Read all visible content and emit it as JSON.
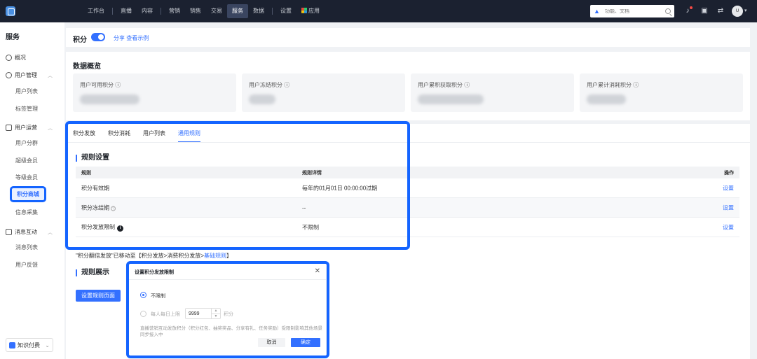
{
  "topbar": {
    "nav": [
      "工作台",
      "直播",
      "内容",
      "营销",
      "销售",
      "交易",
      "服务",
      "数据",
      "设置",
      "应用"
    ],
    "active_nav": "服务",
    "search_placeholder": "功能、文档",
    "avatar_text": "U"
  },
  "sidebar": {
    "title": "服务",
    "overview": "概况",
    "user_mgmt": "用户管理",
    "user_list": "用户列表",
    "tag_mgmt": "标签管理",
    "user_ops": "用户运营",
    "user_group": "用户分群",
    "super_member": "超级会员",
    "level_member": "等级会员",
    "points_mall": "积分商城",
    "info_collect": "信息采集",
    "msg_interact": "消息互动",
    "msg_list": "消息列表",
    "user_feedback": "用户反馈",
    "bottom_label": "知识付费"
  },
  "header": {
    "title": "积分",
    "links": "分享  查看示例",
    "toggle_on": true
  },
  "overview": {
    "title": "数据概览",
    "cards": [
      "用户可用积分 ⓘ",
      "用户冻结积分 ⓘ",
      "用户累积获取积分 ⓘ",
      "用户累计消耗积分 ⓘ"
    ]
  },
  "tabs": [
    "积分发放",
    "积分消耗",
    "用户列表",
    "通用规则"
  ],
  "active_tab": "通用规则",
  "rules": {
    "title": "规则设置",
    "headers": [
      "规则",
      "规则详情",
      "操作"
    ],
    "rows": [
      {
        "rule": "积分有效期",
        "detail": "每年的01月01日 00:00:00过期",
        "action": "设置"
      },
      {
        "rule": "积分冻结期",
        "detail": "--",
        "action": "设置"
      },
      {
        "rule": "积分发放限制",
        "detail": "不限制",
        "action": "设置"
      }
    ]
  },
  "note": {
    "text": "\"积分翻倍发放\"已移动至【积分发放>消费积分发放>",
    "link": "基础规则",
    "tail": "】"
  },
  "display": {
    "title": "规则展示",
    "button": "设置规则页面"
  },
  "modal": {
    "title": "设置积分发放限制",
    "option_unlimited": "不限制",
    "option_daily": "每人每日上限",
    "daily_value": "9999",
    "unit": "积分",
    "desc": "直播营销互动发放积分（积分红包、抽奖奖品、分享有礼、任务奖励）受限制影响其他场景同步接入中",
    "cancel": "取消",
    "confirm": "确定"
  },
  "colors": {
    "accent": "#3370ff",
    "highlight": "#1464ff",
    "topbar": "#1b2130"
  }
}
